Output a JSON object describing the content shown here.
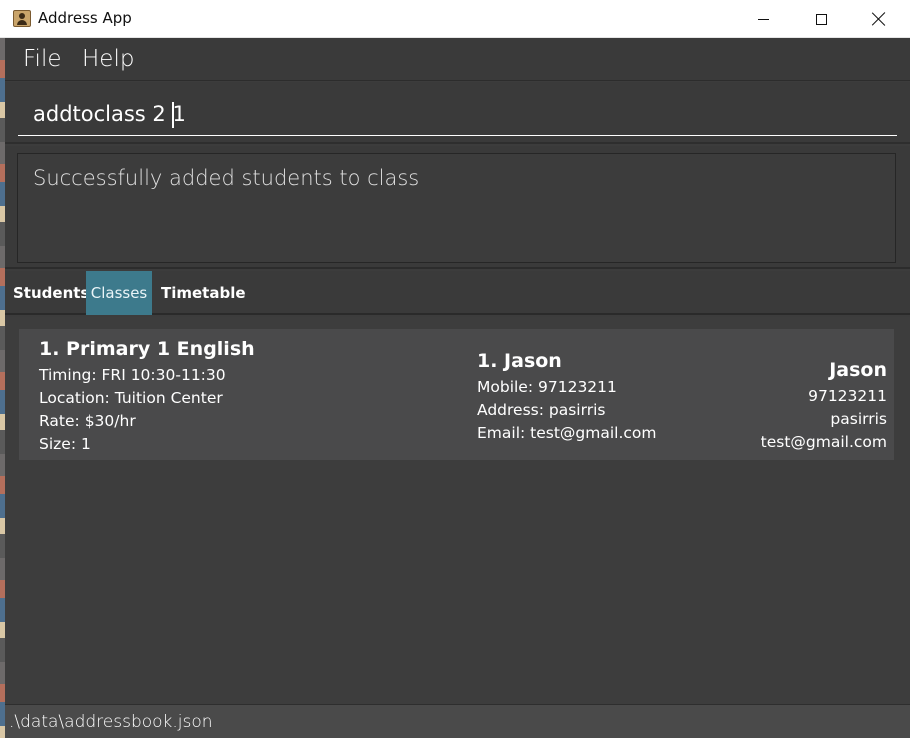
{
  "window": {
    "title": "Address App"
  },
  "menu": {
    "file": "File",
    "help": "Help"
  },
  "command": {
    "value": "addtoclass 2 1"
  },
  "result": {
    "message": "Successfully added students to class"
  },
  "tabs": [
    {
      "label": "Students"
    },
    {
      "label": "Classes"
    },
    {
      "label": "Timetable"
    }
  ],
  "class_card": {
    "title": "1.  Primary 1 English",
    "timing": "Timing: FRI 10:30-11:30",
    "location": "Location: Tuition Center",
    "rate": "Rate: $30/hr",
    "size": "Size: 1",
    "student": {
      "name": "1.  Jason",
      "mobile": "Mobile: 97123211",
      "address": "Address: pasirris",
      "email": "Email: test@gmail.com"
    },
    "summary": {
      "name": "Jason",
      "phone": "97123211",
      "address": "pasirris",
      "email": "test@gmail.com"
    }
  },
  "status": {
    "path": ".\\data\\addressbook.json"
  }
}
